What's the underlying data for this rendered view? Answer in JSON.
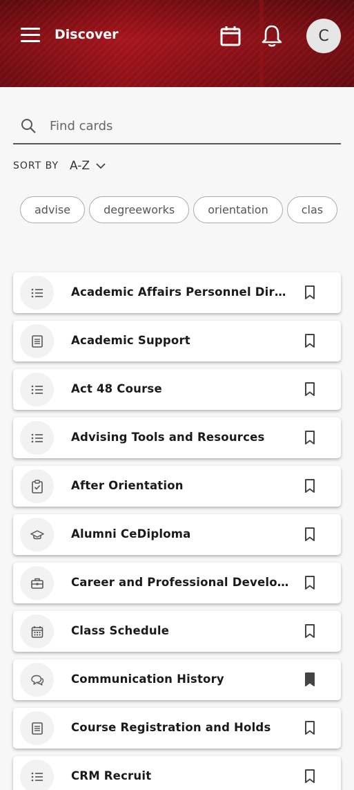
{
  "header": {
    "title": "Discover",
    "avatar_initial": "C"
  },
  "search": {
    "placeholder": "Find cards",
    "value": ""
  },
  "sort": {
    "label": "SORT BY",
    "value": "A-Z"
  },
  "tags": [
    "advise",
    "degreeworks",
    "orientation",
    "clas"
  ],
  "cards": [
    {
      "label": "Academic Affairs Personnel Directory",
      "icon": "list-icon",
      "bookmarked": false
    },
    {
      "label": "Academic Support",
      "icon": "document-icon",
      "bookmarked": false
    },
    {
      "label": "Act 48 Course",
      "icon": "list-icon",
      "bookmarked": false
    },
    {
      "label": "Advising Tools and Resources",
      "icon": "list-icon",
      "bookmarked": false
    },
    {
      "label": "After Orientation",
      "icon": "clipboard-check-icon",
      "bookmarked": false
    },
    {
      "label": "Alumni CeDiploma",
      "icon": "graduation-cap-icon",
      "bookmarked": false
    },
    {
      "label": "Career and Professional Development",
      "icon": "briefcase-icon",
      "bookmarked": false
    },
    {
      "label": "Class Schedule",
      "icon": "calendar-icon",
      "bookmarked": false
    },
    {
      "label": "Communication History",
      "icon": "chat-icon",
      "bookmarked": true
    },
    {
      "label": "Course Registration and Holds",
      "icon": "document-icon",
      "bookmarked": false
    },
    {
      "label": "CRM Recruit",
      "icon": "list-icon",
      "bookmarked": false
    }
  ],
  "colors": {
    "header": "#a7141c",
    "text": "#1a1a1a",
    "icon": "#555555"
  }
}
